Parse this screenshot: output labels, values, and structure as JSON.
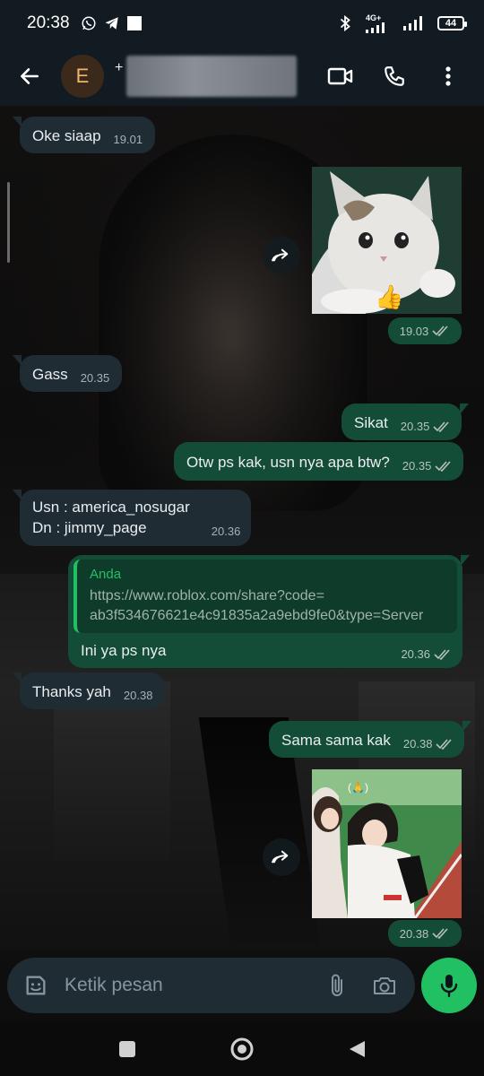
{
  "status_bar": {
    "time": "20:38",
    "network": "4G+",
    "battery": "44"
  },
  "header": {
    "avatar_initial": "E",
    "name_prefix": "+"
  },
  "messages": [
    {
      "dir": "in",
      "text": "Oke siaap",
      "time": "19.01"
    },
    {
      "dir": "out",
      "type": "image",
      "image": "kitten-thumbs-up-sticker",
      "time": "19.03",
      "status": "read"
    },
    {
      "dir": "in",
      "text": "Gass",
      "time": "20.35"
    },
    {
      "dir": "out",
      "text": "Sikat",
      "time": "20.35",
      "status": "read"
    },
    {
      "dir": "out",
      "text": "Otw ps kak, usn nya apa btw?",
      "time": "20.35",
      "status": "read"
    },
    {
      "dir": "in",
      "text": "Usn : america_nosugar\nDn : jimmy_page",
      "time": "20.36"
    },
    {
      "dir": "out",
      "quote_author": "Anda",
      "quote_text": "https://www.roblox.com/share?code=\nab3f534676621e4c91835a2a9ebd9fe0&type=Server",
      "text": "Ini ya ps nya",
      "time": "20.36",
      "status": "read"
    },
    {
      "dir": "in",
      "text": "Thanks yah",
      "time": "20.38"
    },
    {
      "dir": "out",
      "text": "Sama sama kak",
      "time": "20.38",
      "status": "read"
    },
    {
      "dir": "out",
      "type": "image",
      "image": "two-girls-photo",
      "time": "20.38",
      "status": "read"
    }
  ],
  "input": {
    "placeholder": "Ketik pesan"
  },
  "colors": {
    "incoming_bubble": "#1f2c33",
    "outgoing_bubble": "#144d37",
    "accent": "#21c063",
    "header_bg": "#121b22"
  }
}
